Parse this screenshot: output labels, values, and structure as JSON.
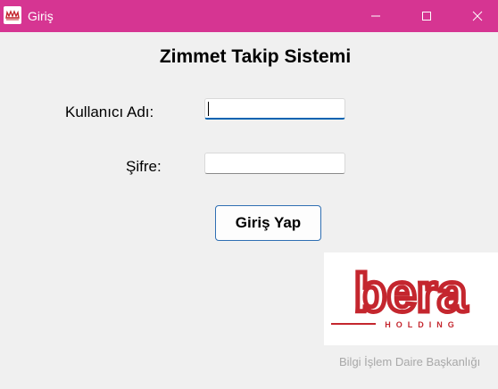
{
  "window": {
    "title": "Giriş",
    "accent_color": "#d63592",
    "controls": [
      "minimize-icon",
      "maximize-icon",
      "close-icon"
    ]
  },
  "form": {
    "heading": "Zimmet Takip Sistemi",
    "username_label": "Kullanıcı Adı:",
    "username_value": "",
    "password_label": "Şifre:",
    "password_value": "",
    "login_button": "Giriş Yap"
  },
  "branding": {
    "logo_text": "bera",
    "logo_subtext": "HOLDING",
    "logo_color": "#c4262e",
    "footer_text": "Bilgi İşlem Daire Başkanlığı"
  }
}
